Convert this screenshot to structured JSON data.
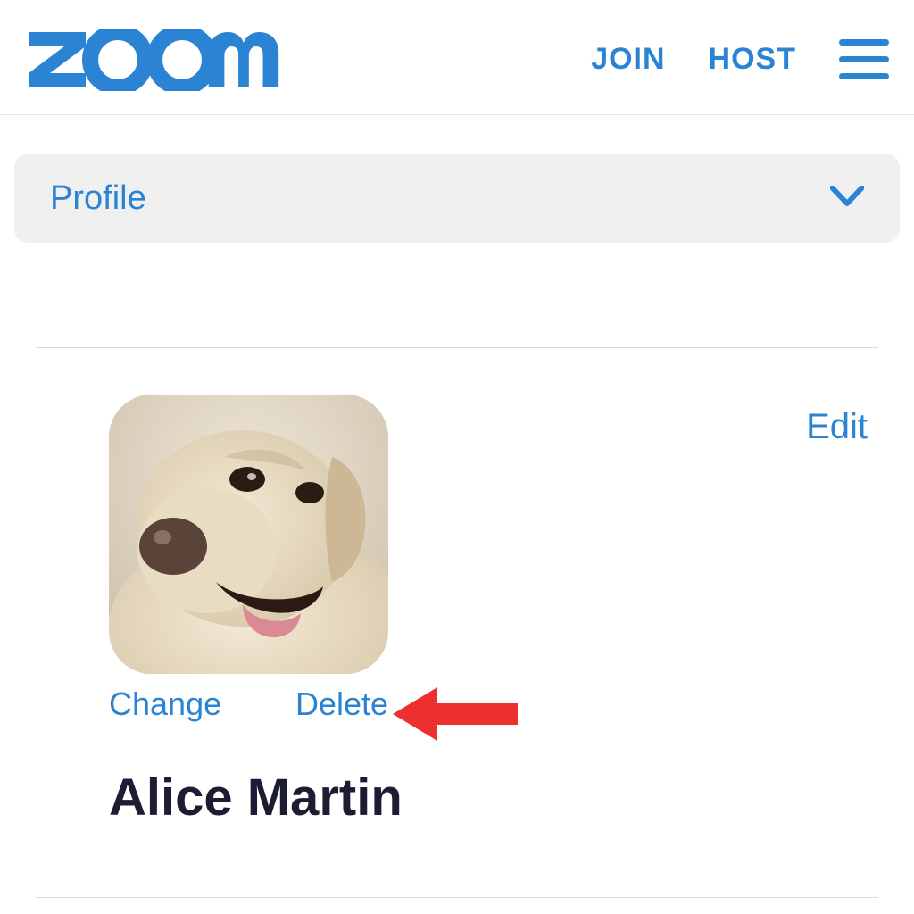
{
  "brand": {
    "name": "zoom"
  },
  "header": {
    "join_label": "JOIN",
    "host_label": "HOST"
  },
  "dropdown": {
    "label": "Profile"
  },
  "profile": {
    "edit_label": "Edit",
    "change_label": "Change",
    "delete_label": "Delete",
    "display_name": "Alice Martin"
  },
  "colors": {
    "brand_blue": "#2b84d3",
    "annotation_red": "#ed2f2f"
  }
}
